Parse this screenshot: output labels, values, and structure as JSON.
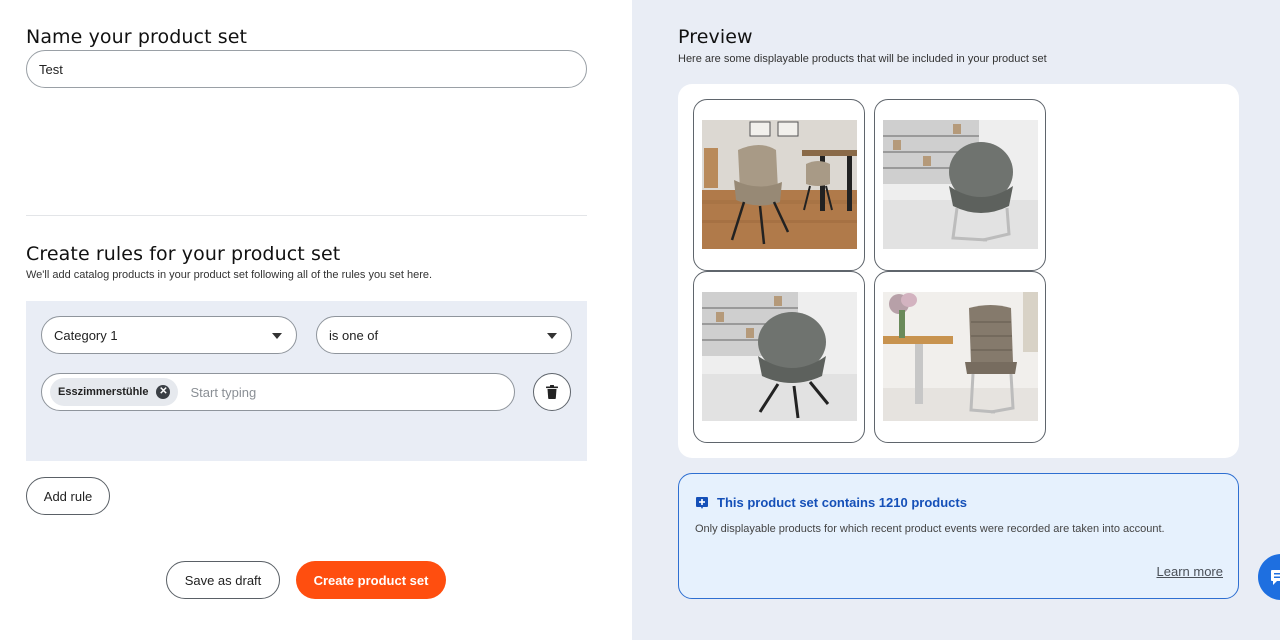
{
  "left": {
    "name_section": {
      "title": "Name your product set",
      "input_value": "Test"
    },
    "rules_section": {
      "title": "Create rules for your product set",
      "subtitle": "We'll add catalog products in your product set following all of the rules you set here.",
      "rule": {
        "field_select": "Category 1",
        "operator_select": "is one of",
        "chip_label": "Esszimmerstühle",
        "typing_placeholder": "Start typing"
      },
      "add_rule_label": "Add rule"
    },
    "footer": {
      "draft_label": "Save as draft",
      "create_label": "Create product set"
    }
  },
  "preview": {
    "title": "Preview",
    "subtitle": "Here are some displayable products that will be included in your product set",
    "products": [
      "chair-beige-armchair",
      "chair-grey-cantilever",
      "chair-grey-swivel",
      "chair-taupe-cantilever"
    ]
  },
  "info": {
    "title": "This product set contains 1210 products",
    "text": "Only displayable products for which recent product events were recorded are taken into account.",
    "link": "Learn more"
  },
  "colors": {
    "accent": "#ff4e0f",
    "info_blue": "#1550b8",
    "panel_bg": "#e9edf5"
  },
  "icons": {
    "caret": "chevron-down-icon",
    "chip_remove": "close-circle-icon",
    "delete": "trash-icon",
    "info": "info-plus-icon",
    "chat": "chat-icon"
  }
}
